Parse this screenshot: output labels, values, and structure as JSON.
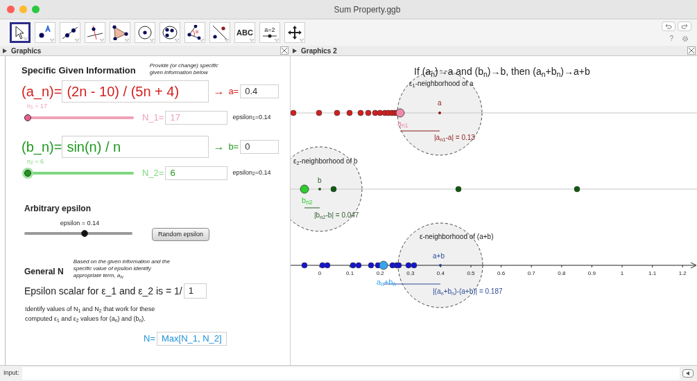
{
  "window": {
    "title": "Sum Property.ggb"
  },
  "toolbar": {
    "tools": [
      {
        "kind": "move",
        "selected": true
      },
      {
        "kind": "point",
        "selected": false
      },
      {
        "kind": "line",
        "selected": false
      },
      {
        "kind": "perpendicular",
        "selected": false
      },
      {
        "kind": "polygon",
        "selected": false
      },
      {
        "kind": "circle",
        "selected": false
      },
      {
        "kind": "conic",
        "selected": false
      },
      {
        "kind": "angle",
        "selected": false
      },
      {
        "kind": "reflect",
        "selected": false
      },
      {
        "kind": "text",
        "label": "ABC",
        "selected": false
      },
      {
        "kind": "slider",
        "label": "a=2",
        "selected": false
      },
      {
        "kind": "pan",
        "selected": false
      }
    ],
    "help": "?"
  },
  "panels": [
    {
      "title": "Graphics"
    },
    {
      "title": "Graphics 2"
    }
  ],
  "given": {
    "heading": "Specific Given Information",
    "note": "Provide (or change) specific given information below",
    "sequences": [
      {
        "name": "(a_n)=",
        "formula": "(2n - 10) / (5n + 4)",
        "arrow": "→",
        "limit_label": "a=",
        "limit": "0.4",
        "color": "#d41f1f",
        "slider": {
          "label": "n$_{1}$ = 17",
          "level": 0,
          "color": "#f0a0b8"
        },
        "n_label": "N_1=",
        "n_value": "17",
        "epsilon": "epsilon$_{1}$=0.14"
      },
      {
        "name": "(b_n)=",
        "formula": "sin(n) / n",
        "arrow": "→",
        "limit_label": "b=",
        "limit": "0",
        "color": "#1f9a1f",
        "slider": {
          "label": "n$_{2}$ = 6",
          "level": 0,
          "color": "#7fd87f"
        },
        "n_label": "N_2=",
        "n_value": "6",
        "epsilon": "epsilon$_{2}$=0.14"
      }
    ]
  },
  "arbitrary": {
    "heading": "Arbitrary epsilon",
    "slider": {
      "label": "epsilon = 0.14",
      "level": 0.56
    },
    "button": "Random epsilon"
  },
  "general": {
    "heading": "General N",
    "note": "Based on the given information and the specific value of epsilon identify appropriate term, a$_{N}$",
    "scalar_label": "Epsilon scalar for ε_1 and ε_2 is = 1/",
    "scalar_value": "1",
    "paragraph": "Identify values of N$_{1}$ and N$_{2}$ that work for these computed ε$_{1}$ and ε$_{2}$ values for (a$_{n}$) and (b$_{n}$).",
    "n_label": "N=",
    "n_value": "Max[N_1, N_2]"
  },
  "graphics2": {
    "title": "If (a$_{n}$)→a and (b$_{n}$)→b, then (a$_{n}$+b$_{n}$)→a+b",
    "rows": [
      {
        "neighborhood": "ε$_{1}$-neighborhood of a",
        "point_label": "a",
        "term_label": "a$_{n1}$",
        "distance": "|a$_{n1}$-a| = 0.13",
        "color": "#d41f1f"
      },
      {
        "neighborhood": "ε$_{2}$-neighborhood of b",
        "point_label": "b",
        "term_label": "b$_{n2}$",
        "distance": "|b$_{n2}$-b| = 0.047",
        "color": "#0f5a0f"
      },
      {
        "neighborhood": "ε-neighborhood of (a+b)",
        "point_label": "a+b",
        "term_label": "a$_{n}$+b$_{n}$",
        "distance": "|(a$_{n}$+b$_{n}$)-(a+b)| = 0.187",
        "color": "#1515d0"
      }
    ],
    "axis_ticks": [
      "0",
      "0.1",
      "0.2",
      "0.3",
      "0.4",
      "0.5",
      "0.6",
      "0.7",
      "0.8",
      "0.9",
      "1",
      "1.1",
      "1.2"
    ]
  },
  "input_bar": {
    "label": "Input:"
  }
}
